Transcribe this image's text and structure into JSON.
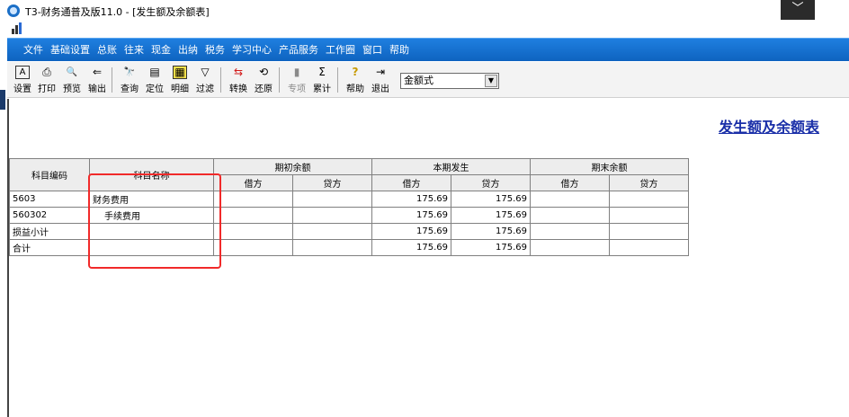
{
  "window": {
    "title": "T3-财务通普及版11.0 - [发生额及余额表]",
    "close_glyph": "﹀"
  },
  "menu": [
    "文件",
    "基础设置",
    "总账",
    "往来",
    "现金",
    "出纳",
    "税务",
    "学习中心",
    "产品服务",
    "工作圈",
    "窗口",
    "帮助"
  ],
  "toolbar": {
    "buttons": [
      {
        "label": "设置",
        "icon": "A"
      },
      {
        "label": "打印",
        "icon": "⎙"
      },
      {
        "label": "预览",
        "icon": "🔍"
      },
      {
        "label": "输出",
        "icon": "⇐"
      },
      {
        "label": "查询",
        "icon": "🔭"
      },
      {
        "label": "定位",
        "icon": "▤"
      },
      {
        "label": "明细",
        "icon": "▦"
      },
      {
        "label": "过滤",
        "icon": "▽"
      },
      {
        "label": "转换",
        "icon": "⇆"
      },
      {
        "label": "还原",
        "icon": "⟲"
      },
      {
        "label": "专项",
        "icon": "▮"
      },
      {
        "label": "累计",
        "icon": "Σ"
      },
      {
        "label": "帮助",
        "icon": "?"
      },
      {
        "label": "退出",
        "icon": "⇥"
      }
    ],
    "mode_select": "金额式"
  },
  "report": {
    "title": "发生额及余额表",
    "headers": {
      "code": "科目编码",
      "name": "科目名称",
      "opening": "期初余额",
      "period": "本期发生",
      "closing": "期末余额",
      "debit": "借方",
      "credit": "贷方"
    },
    "rows": [
      {
        "code": "5603",
        "name": "财务费用",
        "open_debit": "",
        "open_credit": "",
        "period_debit": "175.69",
        "period_credit": "175.69",
        "close_debit": "",
        "close_credit": ""
      },
      {
        "code": "560302",
        "name": "  手续费用",
        "open_debit": "",
        "open_credit": "",
        "period_debit": "175.69",
        "period_credit": "175.69",
        "close_debit": "",
        "close_credit": ""
      },
      {
        "code": "损益小计",
        "name": "",
        "open_debit": "",
        "open_credit": "",
        "period_debit": "175.69",
        "period_credit": "175.69",
        "close_debit": "",
        "close_credit": ""
      },
      {
        "code": "合计",
        "name": "",
        "open_debit": "",
        "open_credit": "",
        "period_debit": "175.69",
        "period_credit": "175.69",
        "close_debit": "",
        "close_credit": ""
      }
    ]
  },
  "colors": {
    "menubar": "#1273d4",
    "report_title": "#1a2fa8",
    "highlight": "#f12a2a"
  }
}
